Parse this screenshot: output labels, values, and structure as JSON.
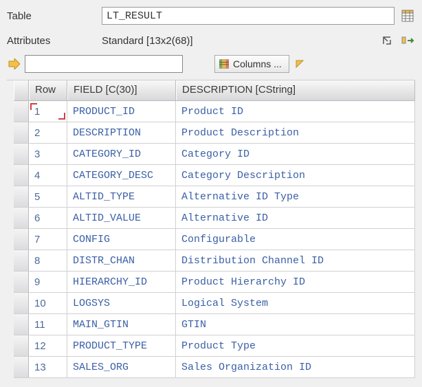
{
  "labels": {
    "table": "Table",
    "attributes": "Attributes"
  },
  "table_input_value": "LT_RESULT",
  "attributes_value": "Standard [13x2(68)]",
  "toolbar": {
    "columns_label": "Columns ..."
  },
  "grid": {
    "headers": {
      "row": "Row",
      "field": "FIELD [C(30)]",
      "description": "DESCRIPTION [CString]"
    },
    "rows": [
      {
        "n": "1",
        "field": "PRODUCT_ID",
        "desc": "Product ID",
        "selected": true
      },
      {
        "n": "2",
        "field": "DESCRIPTION",
        "desc": "Product Description",
        "selected": false
      },
      {
        "n": "3",
        "field": "CATEGORY_ID",
        "desc": "Category ID",
        "selected": false
      },
      {
        "n": "4",
        "field": "CATEGORY_DESC",
        "desc": "Category Description",
        "selected": false
      },
      {
        "n": "5",
        "field": "ALTID_TYPE",
        "desc": "Alternative ID Type",
        "selected": false
      },
      {
        "n": "6",
        "field": "ALTID_VALUE",
        "desc": "Alternative ID",
        "selected": false
      },
      {
        "n": "7",
        "field": "CONFIG",
        "desc": "Configurable",
        "selected": false
      },
      {
        "n": "8",
        "field": "DISTR_CHAN",
        "desc": "Distribution Channel ID",
        "selected": false
      },
      {
        "n": "9",
        "field": "HIERARCHY_ID",
        "desc": "Product Hierarchy ID",
        "selected": false
      },
      {
        "n": "10",
        "field": "LOGSYS",
        "desc": "Logical System",
        "selected": false
      },
      {
        "n": "11",
        "field": "MAIN_GTIN",
        "desc": "GTIN",
        "selected": false
      },
      {
        "n": "12",
        "field": "PRODUCT_TYPE",
        "desc": "Product Type",
        "selected": false
      },
      {
        "n": "13",
        "field": "SALES_ORG",
        "desc": "Sales Organization ID",
        "selected": false
      }
    ]
  }
}
